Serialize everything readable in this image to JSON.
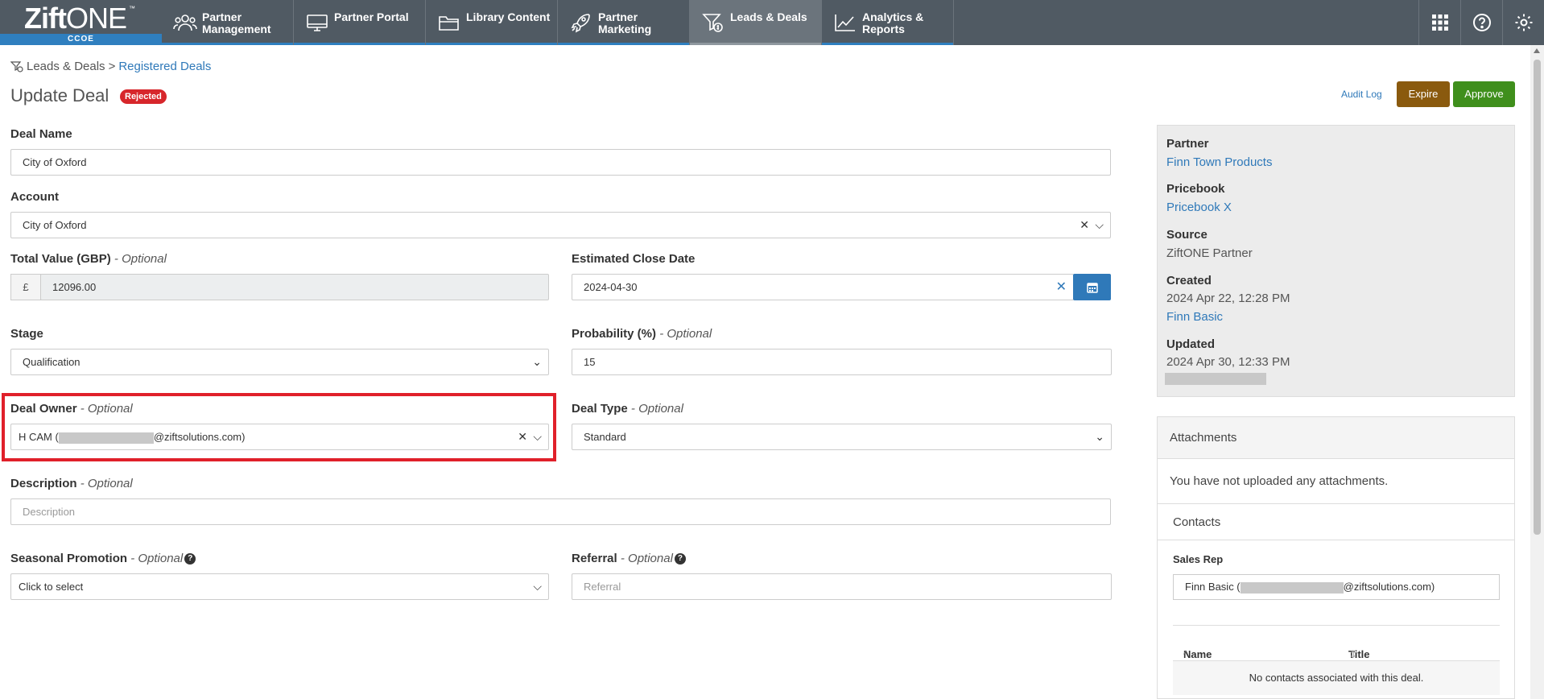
{
  "nav": {
    "logo_text": "Zift",
    "logo_text2": "ONE",
    "logo_tm": "™",
    "logo_sub": "CCOE",
    "items": [
      {
        "label": "Partner Management",
        "icon": "users-icon"
      },
      {
        "label": "Partner Portal",
        "icon": "monitor-icon"
      },
      {
        "label": "Library Content",
        "icon": "folder-icon"
      },
      {
        "label": "Partner Marketing",
        "icon": "rocket-icon"
      },
      {
        "label": "Leads & Deals",
        "icon": "funnel-dollar-icon",
        "active": true
      },
      {
        "label": "Analytics & Reports",
        "icon": "line-chart-icon"
      }
    ],
    "right_icons": [
      "grid-icon",
      "help-icon",
      "settings-icon"
    ]
  },
  "breadcrumb": {
    "root": "Leads & Deals",
    "separator": ">",
    "current": "Registered Deals"
  },
  "page": {
    "title": "Update Deal",
    "status_badge": "Rejected"
  },
  "actions": {
    "audit_log": "Audit Log",
    "expire": "Expire",
    "approve": "Approve"
  },
  "form": {
    "deal_name": {
      "label": "Deal Name",
      "value": "City of Oxford"
    },
    "account": {
      "label": "Account",
      "value": "City of Oxford"
    },
    "total_value": {
      "label": "Total Value (GBP)",
      "optional": "- Optional",
      "prefix": "£",
      "value": "12096.00"
    },
    "close_date": {
      "label": "Estimated Close Date",
      "value": "2024-04-30"
    },
    "stage": {
      "label": "Stage",
      "value": "Qualification"
    },
    "probability": {
      "label": "Probability (%)",
      "optional": "- Optional",
      "value": "15"
    },
    "deal_owner": {
      "label": "Deal Owner",
      "optional": "- Optional",
      "value_prefix": "H CAM (",
      "value_suffix": "@ziftsolutions.com)"
    },
    "deal_type": {
      "label": "Deal Type",
      "optional": "- Optional",
      "value": "Standard"
    },
    "description": {
      "label": "Description",
      "optional": "- Optional",
      "placeholder": "Description"
    },
    "seasonal_promotion": {
      "label": "Seasonal Promotion",
      "optional": "- Optional",
      "value": "Click to select"
    },
    "referral": {
      "label": "Referral",
      "optional": "- Optional",
      "placeholder": "Referral"
    }
  },
  "info": {
    "partner_label": "Partner",
    "partner": "Finn Town Products",
    "pricebook_label": "Pricebook",
    "pricebook": "Pricebook X",
    "source_label": "Source",
    "source": "ZiftONE Partner",
    "created_label": "Created",
    "created": "2024 Apr 22, 12:28 PM",
    "created_by": "Finn Basic",
    "updated_label": "Updated",
    "updated": "2024 Apr 30, 12:33 PM"
  },
  "attachments": {
    "title": "Attachments",
    "empty": "You have not uploaded any attachments."
  },
  "contacts": {
    "title": "Contacts",
    "sales_rep_label": "Sales Rep",
    "sales_rep_prefix": "Finn Basic (",
    "sales_rep_suffix": "@ziftsolutions.com)",
    "col_name": "Name",
    "col_title": "Title",
    "empty": "No contacts associated with this deal."
  },
  "colors": {
    "nav_bg": "#505a63",
    "accent": "#2f79b9",
    "rejected": "#d7262b",
    "expire": "#8a5a0e",
    "approve": "#3f8f1c",
    "highlight": "#e0202a"
  }
}
